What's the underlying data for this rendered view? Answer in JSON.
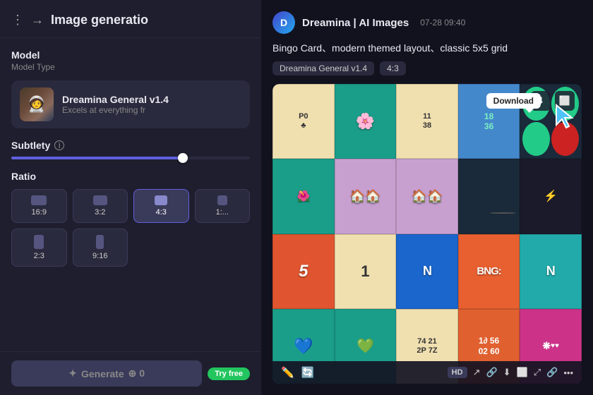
{
  "leftPanel": {
    "title": "Image generatio",
    "modelSection": {
      "label": "Model",
      "subLabel": "Model Type",
      "modelName": "Dreamina General v1.4",
      "modelDesc": "Excels at everything fr",
      "modelEmoji": "🧑‍🚀"
    },
    "subtlety": {
      "label": "Subtlety",
      "infoIcon": "i"
    },
    "ratio": {
      "label": "Ratio",
      "options": [
        {
          "label": "16:9",
          "w": 20,
          "h": 13,
          "active": false
        },
        {
          "label": "3:2",
          "w": 18,
          "h": 13,
          "active": false
        },
        {
          "label": "4:3",
          "w": 16,
          "h": 13,
          "active": true
        },
        {
          "label": "1:...",
          "w": 13,
          "h": 13,
          "active": false
        }
      ],
      "options2": [
        {
          "label": "2:3",
          "w": 13,
          "h": 18,
          "active": false
        },
        {
          "label": "9:16",
          "w": 10,
          "h": 18,
          "active": false
        }
      ]
    },
    "generateBtn": {
      "label": "Generate",
      "icon": "+",
      "count": "0"
    },
    "tryFreeBadge": "Try free"
  },
  "rightPanel": {
    "appName": "Dreamina | AI Images",
    "timestamp": "07-28   09:40",
    "prompt": "Bingo Card、modern themed layout、classic 5x5 grid",
    "tags": [
      "Dreamina General v1.4",
      "4:3"
    ],
    "downloadTooltip": "Download",
    "imageToolbar": {
      "hdLabel": "HD",
      "icons": [
        "↗",
        "🔗",
        "⬇",
        "⬜",
        "⤢",
        "🔗",
        "•••"
      ]
    },
    "bottomIcons": [
      "✏️",
      "🔄"
    ]
  }
}
